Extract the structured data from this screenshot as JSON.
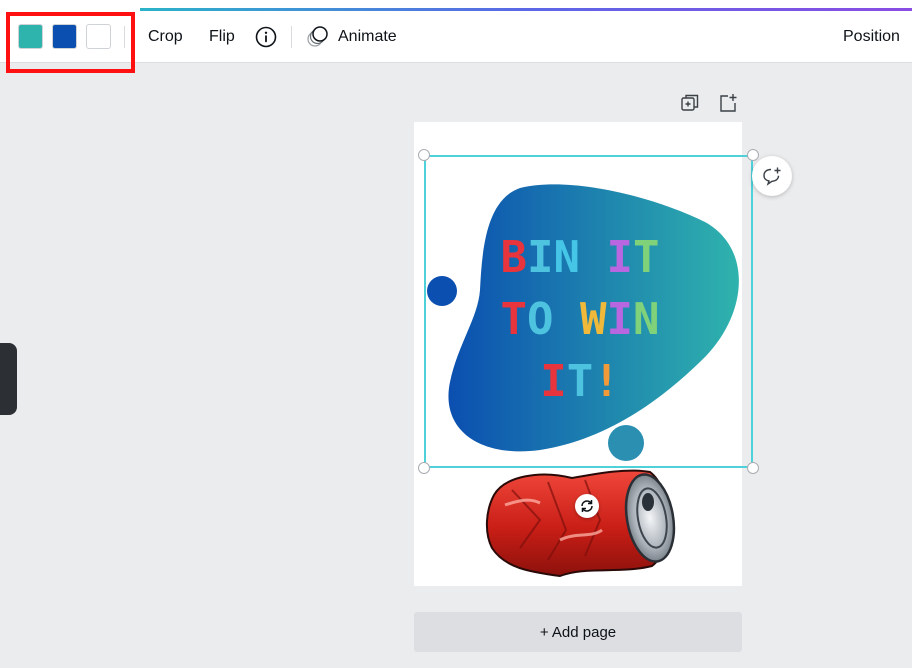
{
  "toolbar": {
    "swatches": [
      "#2fb3ad",
      "#0b4fb0",
      "#ffffff"
    ],
    "crop_label": "Crop",
    "flip_label": "Flip",
    "animate_label": "Animate",
    "position_label": "Position"
  },
  "highlight_color": "#ff1111",
  "design": {
    "headline_lines": [
      [
        {
          "t": "B",
          "c": "#e8343c"
        },
        {
          "t": "I",
          "c": "#4ec3e0"
        },
        {
          "t": "N",
          "c": "#45c6e6"
        },
        {
          "t": " ",
          "c": "#ffffff"
        },
        {
          "t": "I",
          "c": "#b967e0"
        },
        {
          "t": "T",
          "c": "#7fd17a"
        }
      ],
      [
        {
          "t": "T",
          "c": "#e8343c"
        },
        {
          "t": "O",
          "c": "#4ec3e0"
        },
        {
          "t": " ",
          "c": "#ffffff"
        },
        {
          "t": "W",
          "c": "#f1b93a"
        },
        {
          "t": "I",
          "c": "#b967e0"
        },
        {
          "t": "N",
          "c": "#7fd17a"
        }
      ],
      [
        {
          "t": "I",
          "c": "#e8343c"
        },
        {
          "t": "T",
          "c": "#4ec3e0"
        },
        {
          "t": "!",
          "c": "#f29a3a"
        }
      ]
    ],
    "blob_gradient": [
      "#0b4fb0",
      "#2fb3ad"
    ],
    "dot_colors": [
      "#0b4fb0",
      "#2a8fb0"
    ],
    "can_color": "#d92a1f"
  },
  "icons": {
    "info": "info-icon",
    "animate": "animate-icon",
    "duplicate": "duplicate-page-icon",
    "add_page": "add-page-icon",
    "comment": "add-comment-icon",
    "rotate": "rotate-icon"
  },
  "add_page_label": "+ Add page"
}
